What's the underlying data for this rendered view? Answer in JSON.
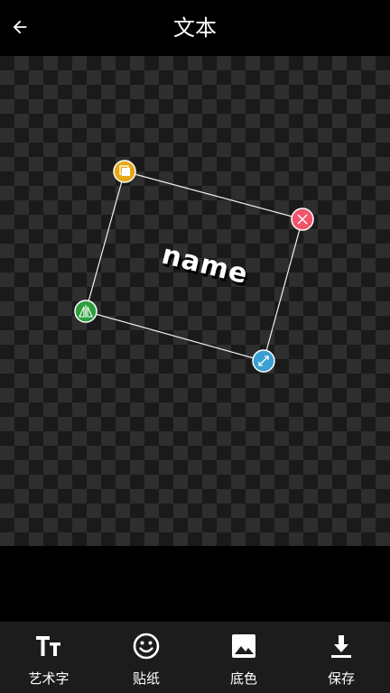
{
  "header": {
    "title": "文本",
    "back_icon": "arrow-left-icon"
  },
  "canvas": {
    "sticker_text": "name",
    "handles": {
      "top_left": {
        "icon": "layers-icon",
        "color": "#e6a817"
      },
      "top_right": {
        "icon": "close-icon",
        "color": "#f0566b"
      },
      "bottom_left": {
        "icon": "mirror-icon",
        "color": "#2e9e3e"
      },
      "bottom_right": {
        "icon": "resize-icon",
        "color": "#3a9fd1"
      }
    }
  },
  "toolbar": {
    "items": [
      {
        "label": "艺术字",
        "icon": "text-style-icon"
      },
      {
        "label": "贴纸",
        "icon": "smiley-icon"
      },
      {
        "label": "底色",
        "icon": "image-icon"
      },
      {
        "label": "保存",
        "icon": "download-icon"
      }
    ]
  }
}
